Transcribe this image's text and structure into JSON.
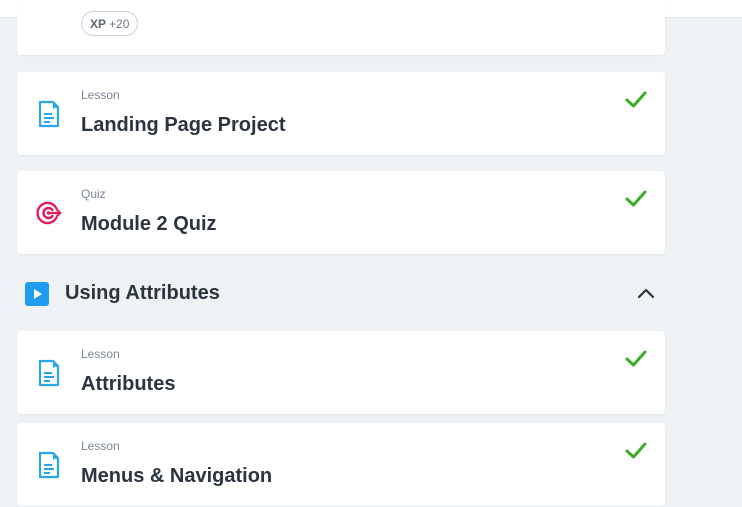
{
  "xp_badge": {
    "label": "XP",
    "value": "+20"
  },
  "items": [
    {
      "kind": "Lesson",
      "title": "Landing Page Project",
      "icon": "lesson-icon",
      "status": "completed"
    },
    {
      "kind": "Quiz",
      "title": "Module 2 Quiz",
      "icon": "target-icon",
      "status": "completed"
    }
  ],
  "section": {
    "title": "Using Attributes",
    "icon": "play-icon",
    "state": "expanded"
  },
  "section_items": [
    {
      "kind": "Lesson",
      "title": "Attributes",
      "icon": "lesson-icon",
      "status": "completed"
    },
    {
      "kind": "Lesson",
      "title": "Menus & Navigation",
      "icon": "lesson-icon",
      "status": "completed"
    }
  ],
  "colors": {
    "lesson": "#2aa6e8",
    "quiz": "#e01e5a",
    "check": "#3aae27",
    "play": "#1e9df0",
    "accent": "#f5a623"
  }
}
